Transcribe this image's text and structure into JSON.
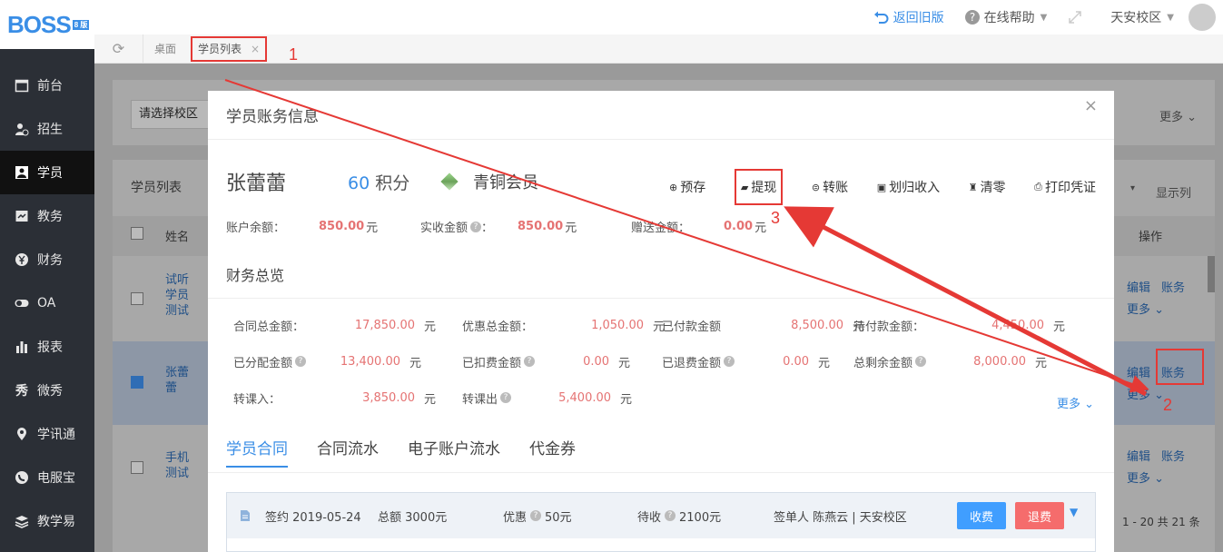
{
  "app": {
    "logo": "BOSS",
    "logo_tag": "8 版"
  },
  "topbar": {
    "back_label": "返回旧版",
    "help_label": "在线帮助",
    "campus_label": "天安校区"
  },
  "tabsbar": {
    "tabs": [
      {
        "label": "桌面"
      },
      {
        "label": "学员列表",
        "close": "×"
      }
    ]
  },
  "sidebar": {
    "items": [
      {
        "label": "前台",
        "icon": "calendar-icon"
      },
      {
        "label": "招生",
        "icon": "user-add-icon"
      },
      {
        "label": "学员",
        "icon": "student-icon",
        "active": true
      },
      {
        "label": "教务",
        "icon": "book-icon"
      },
      {
        "label": "财务",
        "icon": "yen-icon"
      },
      {
        "label": "OA",
        "icon": "toggle-icon"
      },
      {
        "label": "报表",
        "icon": "bar-chart-icon"
      },
      {
        "label": "微秀",
        "icon": "xiu-icon"
      },
      {
        "label": "学讯通",
        "icon": "location-icon"
      },
      {
        "label": "电服宝",
        "icon": "phone-icon"
      },
      {
        "label": "教学易",
        "icon": "layers-icon"
      }
    ]
  },
  "background": {
    "campus_select": "请选择校区",
    "more": "更多",
    "list_title": "学员列表",
    "show_columns": "显示列",
    "header_name": "姓名",
    "header_ops": "操作",
    "rows": [
      {
        "name": "试听学员测试",
        "edit": "编辑",
        "account": "账务",
        "more": "更多"
      },
      {
        "name": "张蕾蕾",
        "edit": "编辑",
        "account": "账务",
        "more": "更多"
      },
      {
        "name": "手机测试",
        "edit": "编辑",
        "account": "账务",
        "more": "更多"
      }
    ],
    "pager": "1 - 20  共 21 条"
  },
  "modal": {
    "title": "学员账务信息",
    "close": "×",
    "student_name": "张蕾蕾",
    "points_value": "60",
    "points_unit": "积分",
    "member_level": "青铜会员",
    "actions": [
      {
        "label": "预存",
        "icon": "deposit-icon"
      },
      {
        "label": "提现",
        "icon": "wallet-icon"
      },
      {
        "label": "转账",
        "icon": "transfer-icon"
      },
      {
        "label": "划归收入",
        "icon": "income-icon"
      },
      {
        "label": "清零",
        "icon": "clear-icon"
      },
      {
        "label": "打印凭证",
        "icon": "print-icon"
      }
    ],
    "balance": {
      "account_label": "账户余额：",
      "account_value": "850.00",
      "received_label": "实收金额",
      "received_value": "850.00",
      "gift_label": "赠送金额：",
      "gift_value": "0.00",
      "unit": "元"
    },
    "finance_title": "财务总览",
    "finance": [
      [
        {
          "label": "合同总金额：",
          "value": "17,850.00",
          "unit": "元"
        },
        {
          "label": "优惠总金额：",
          "value": "1,050.00",
          "unit": "元"
        },
        {
          "label": "已付款金额",
          "value": "8,500.00",
          "unit": "元"
        },
        {
          "label": "待付款金额：",
          "value": "4,450.00",
          "unit": "元"
        }
      ],
      [
        {
          "label": "已分配金额",
          "value": "13,400.00",
          "unit": "元"
        },
        {
          "label": "已扣费金额",
          "value": "0.00",
          "unit": "元"
        },
        {
          "label": "已退费金额",
          "value": "0.00",
          "unit": "元"
        },
        {
          "label": "总剩余金额",
          "value": "8,000.00",
          "unit": "元"
        }
      ],
      [
        {
          "label": "转课入：",
          "value": "3,850.00",
          "unit": "元"
        },
        {
          "label": "转课出",
          "value": "5,400.00",
          "unit": "元"
        }
      ]
    ],
    "finance_more": "更多",
    "tabs": [
      "学员合同",
      "合同流水",
      "电子账户流水",
      "代金券"
    ],
    "contract": {
      "signed": "签约 2019-05-24",
      "total": "总额 3000元",
      "discount_label": "优惠",
      "discount_value": "50元",
      "pending_label": "待收",
      "pending_value": "2100元",
      "signer": "签单人 陈燕云 | 天安校区",
      "pay_button": "收费",
      "refund_button": "退费"
    }
  },
  "annotations": [
    "1",
    "2",
    "3"
  ],
  "colors": {
    "accent": "#3a8ee6",
    "money": "#e57373",
    "annotation": "#e53935",
    "sidebar": "#2b2f36"
  }
}
